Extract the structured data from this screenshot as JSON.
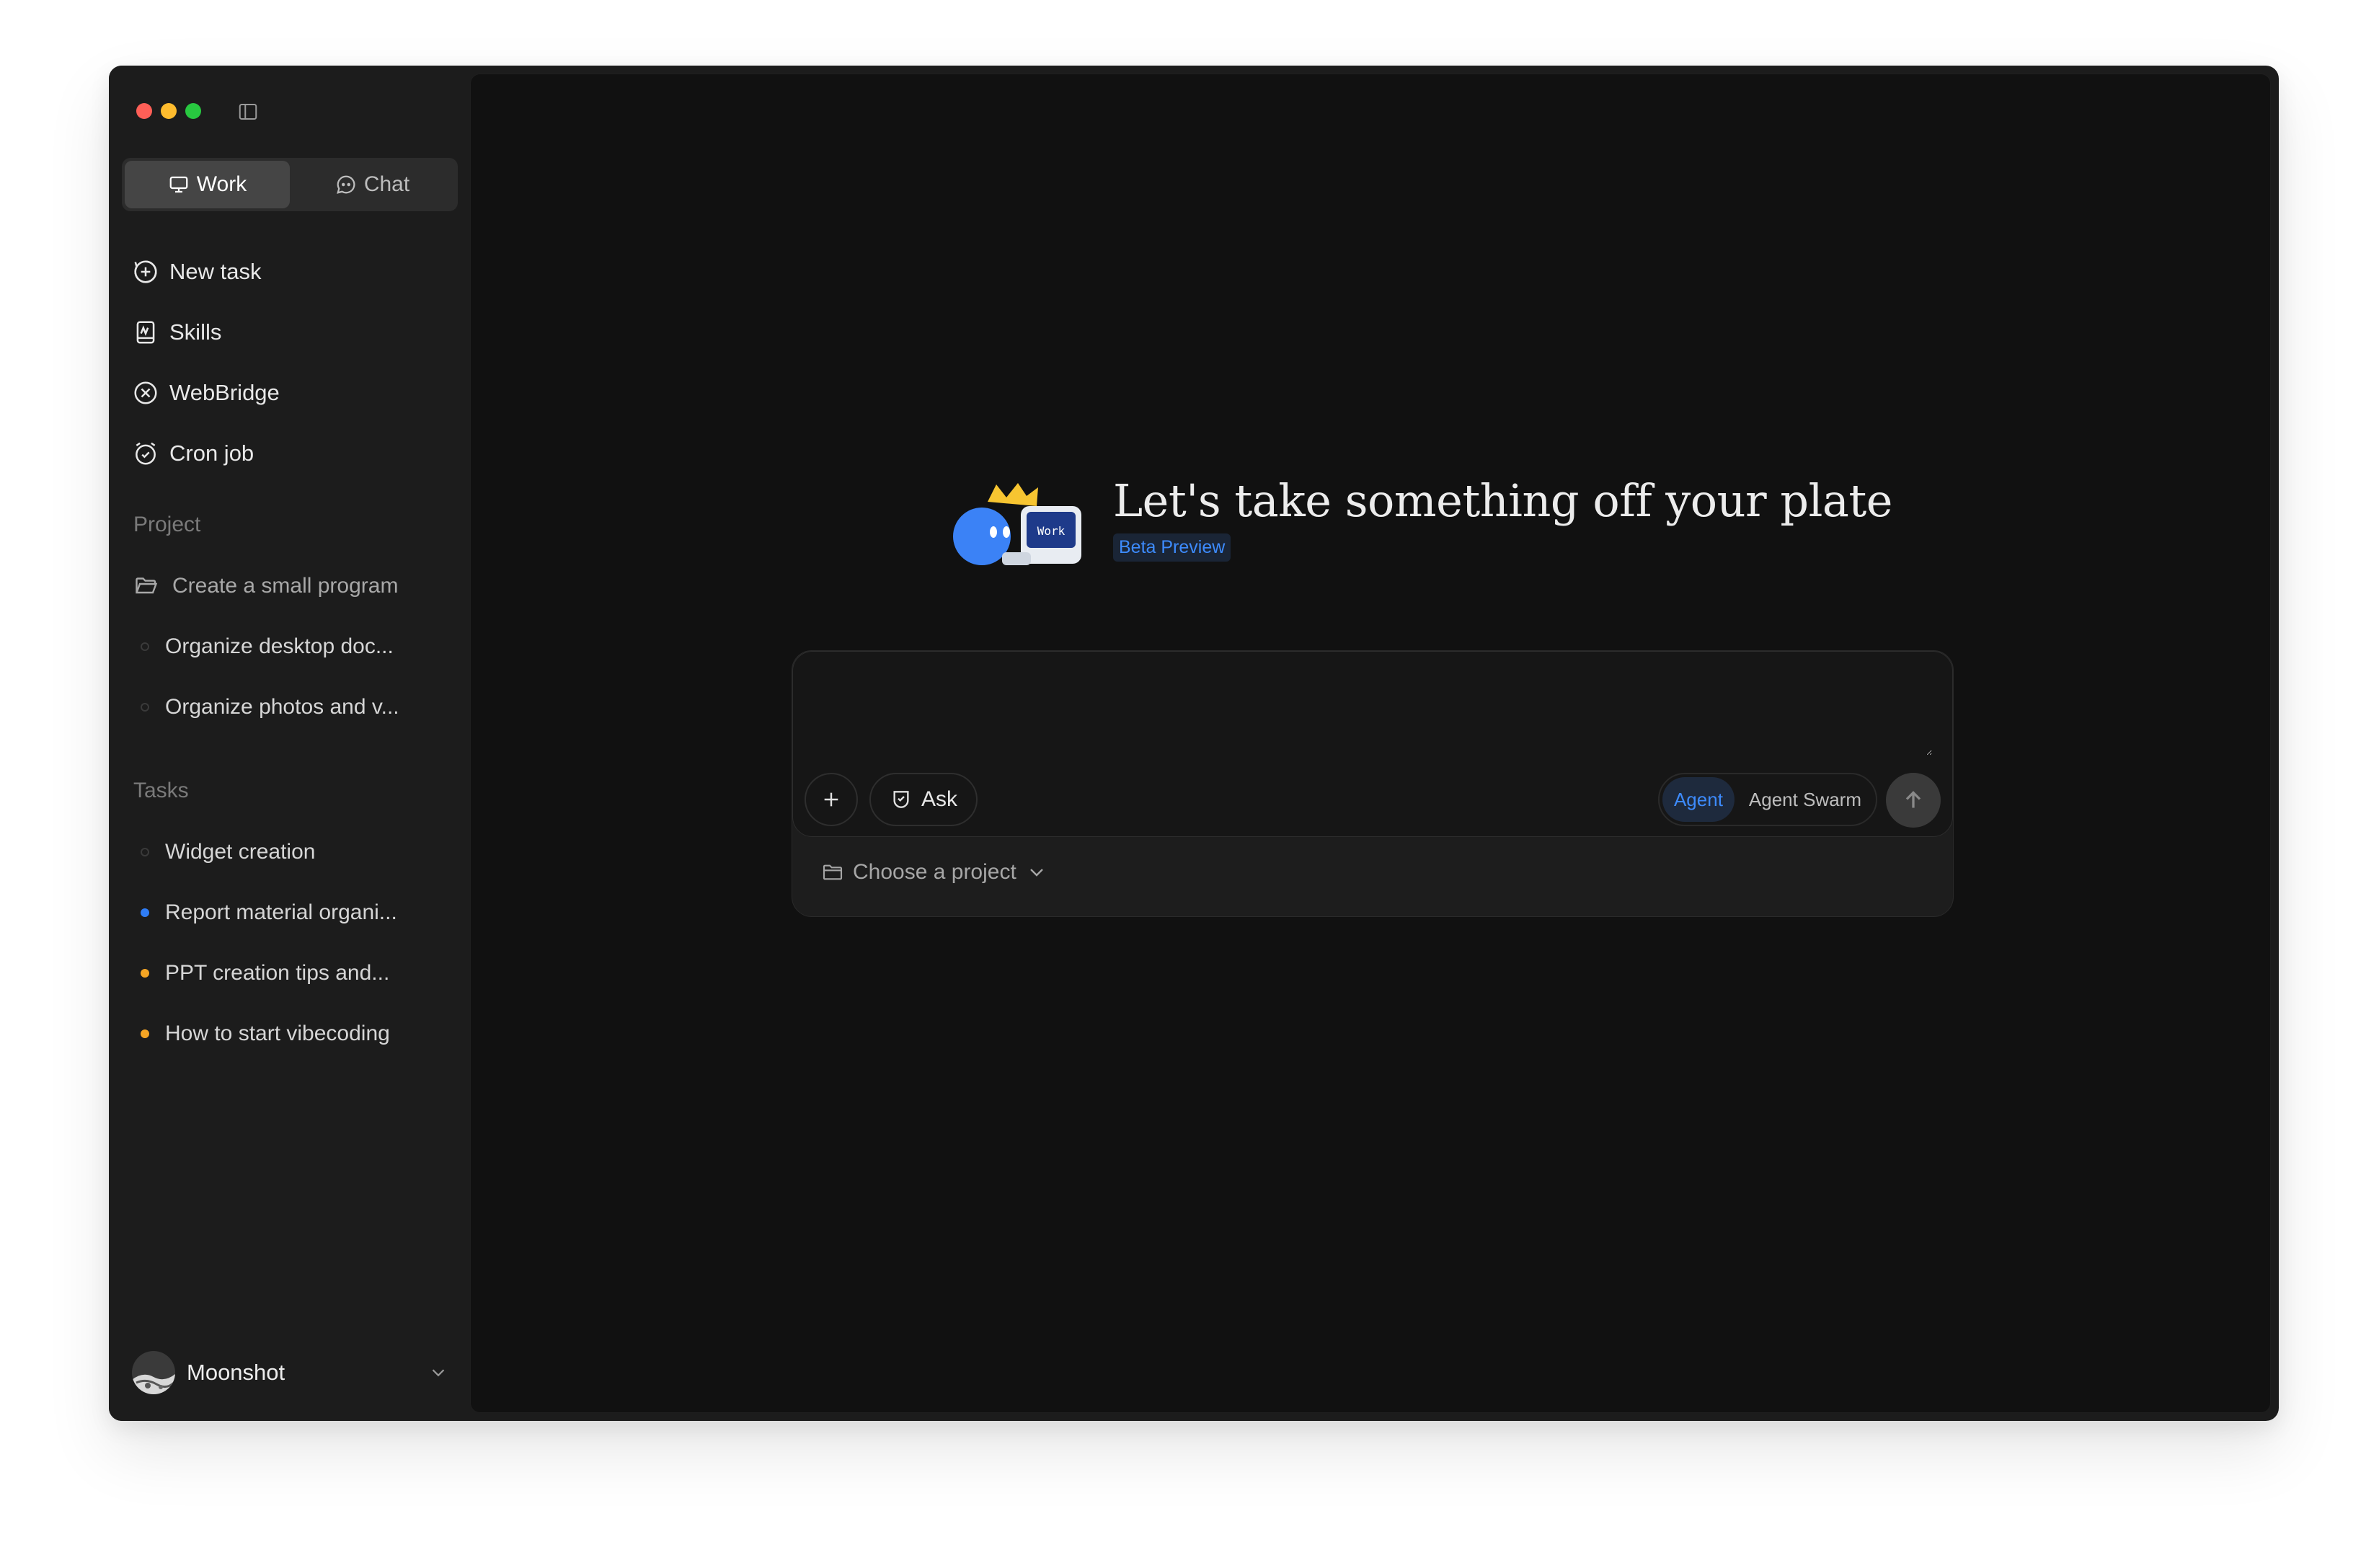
{
  "window": {
    "traffic_lights": {
      "close": "#ff5f57",
      "minimize": "#febc2e",
      "zoom": "#28c840"
    }
  },
  "sidebar": {
    "mode_tabs": [
      {
        "label": "Work",
        "icon": "monitor-icon",
        "active": true
      },
      {
        "label": "Chat",
        "icon": "chat-bubble-icon",
        "active": false
      }
    ],
    "nav": [
      {
        "label": "New task",
        "icon": "plus-circle-icon"
      },
      {
        "label": "Skills",
        "icon": "skills-book-icon"
      },
      {
        "label": "WebBridge",
        "icon": "webbridge-icon"
      },
      {
        "label": "Cron job",
        "icon": "alarm-clock-icon"
      }
    ],
    "project_section": {
      "label": "Project",
      "items": [
        {
          "label": "Create a small program",
          "icon": "folder-open-icon"
        },
        {
          "label": "Organize desktop doc...",
          "status": "empty"
        },
        {
          "label": "Organize photos and v...",
          "status": "empty"
        }
      ]
    },
    "tasks_section": {
      "label": "Tasks",
      "items": [
        {
          "label": "Widget creation",
          "status": "empty"
        },
        {
          "label": "Report material organi...",
          "status": "blue"
        },
        {
          "label": "PPT creation tips and...",
          "status": "orange"
        },
        {
          "label": "How to start vibecoding",
          "status": "orange"
        }
      ]
    },
    "account": {
      "name": "Moonshot"
    }
  },
  "main": {
    "headline": "Let's take something off your plate",
    "badge": "Beta Preview",
    "mascot_text": "Work",
    "composer": {
      "placeholder": "",
      "value": "",
      "ask_label": "Ask",
      "modes": [
        {
          "label": "Agent",
          "active": true
        },
        {
          "label": "Agent Swarm",
          "active": false
        }
      ],
      "project_picker_label": "Choose a project"
    }
  },
  "colors": {
    "accent": "#3d8bfd",
    "sidebar_bg": "#1c1c1c",
    "main_bg": "#111111",
    "status_blue": "#2f7df6",
    "status_orange": "#f5a524"
  }
}
